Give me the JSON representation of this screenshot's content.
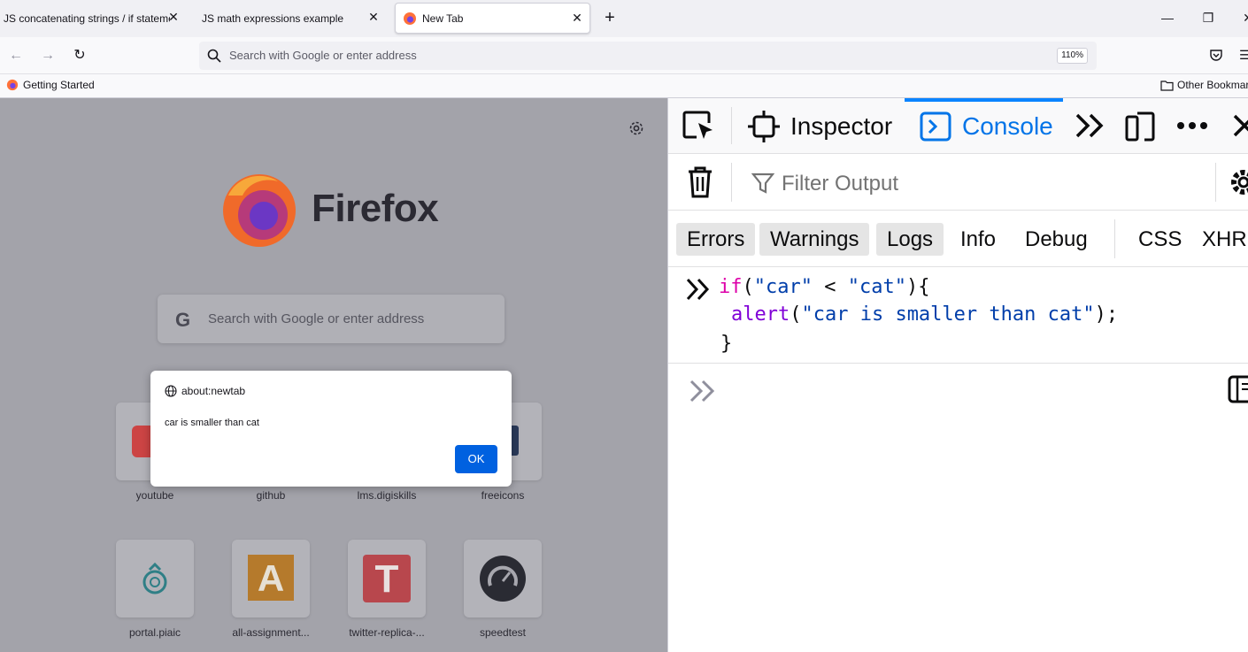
{
  "tabs": [
    {
      "label": "JS concatenating strings / if statements",
      "active": false
    },
    {
      "label": "JS math expressions example",
      "active": false
    },
    {
      "label": "New Tab",
      "active": true
    }
  ],
  "navbar": {
    "url_placeholder": "Search with Google or enter address",
    "zoom": "110%"
  },
  "bookmarks": {
    "getting_started": "Getting Started",
    "other": "Other Bookmarks"
  },
  "newtab": {
    "brand": "Firefox",
    "search_placeholder": "Search with Google or enter address",
    "search_engine_glyph": "G",
    "tiles_row1": [
      "youtube",
      "github",
      "lms.digiskills",
      "freeicons"
    ],
    "tiles_row2": [
      "portal.piaic",
      "all-assignment...",
      "twitter-replica-...",
      "speedtest"
    ],
    "tile_glyphs": {
      "all_assignment": "A",
      "twitter_replica": "T"
    }
  },
  "dialog": {
    "origin": "about:newtab",
    "message": "car is smaller than cat",
    "ok_label": "OK"
  },
  "devtools": {
    "tabs": {
      "inspector": "Inspector",
      "console": "Console"
    },
    "filter_placeholder": "Filter Output",
    "levels": [
      {
        "label": "Errors",
        "on": true
      },
      {
        "label": "Warnings",
        "on": true
      },
      {
        "label": "Logs",
        "on": true
      },
      {
        "label": "Info",
        "on": false
      },
      {
        "label": "Debug",
        "on": false
      },
      {
        "label": "CSS",
        "on": false
      },
      {
        "label": "XHR",
        "on": false
      }
    ],
    "code": {
      "line1": {
        "kw": "if",
        "p1": "(",
        "s1": "\"car\"",
        "op": " < ",
        "s2": "\"cat\"",
        "p2": "){"
      },
      "line2": {
        "fn": "alert",
        "p1": "(",
        "s1": "\"car is smaller than cat\"",
        "p2": ");"
      },
      "line3": "}"
    }
  },
  "colors": {
    "accent": "#0061e0",
    "devtools_selected": "#0074e8"
  }
}
